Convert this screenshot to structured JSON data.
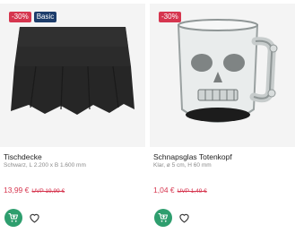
{
  "products": [
    {
      "badges": {
        "discount": "-30%",
        "label": "Basic"
      },
      "title": "Tischdecke",
      "subtitle": "Schwarz, L 2.200 x B 1.600 mm",
      "price": "13,99 €",
      "uvp": "UVP 19,99 €",
      "image_icon": "black-tablecloth-image",
      "actions": {
        "cart_icon": "shopping-cart-icon",
        "wishlist_icon": "heart-icon"
      }
    },
    {
      "badges": {
        "discount": "-30%"
      },
      "title": "Schnapsglas Totenkopf",
      "subtitle": "Klar, ø 5 cm, H 60 mm",
      "price": "1,04 €",
      "uvp": "UVP 1,49 €",
      "image_icon": "skull-shot-glass-image",
      "actions": {
        "cart_icon": "shopping-cart-icon",
        "wishlist_icon": "heart-icon"
      }
    }
  ],
  "colors": {
    "sale": "#d6364f",
    "basic_badge": "#1d3d6b",
    "cart_button": "#2e9e6e",
    "image_bg": "#f4f4f4"
  }
}
